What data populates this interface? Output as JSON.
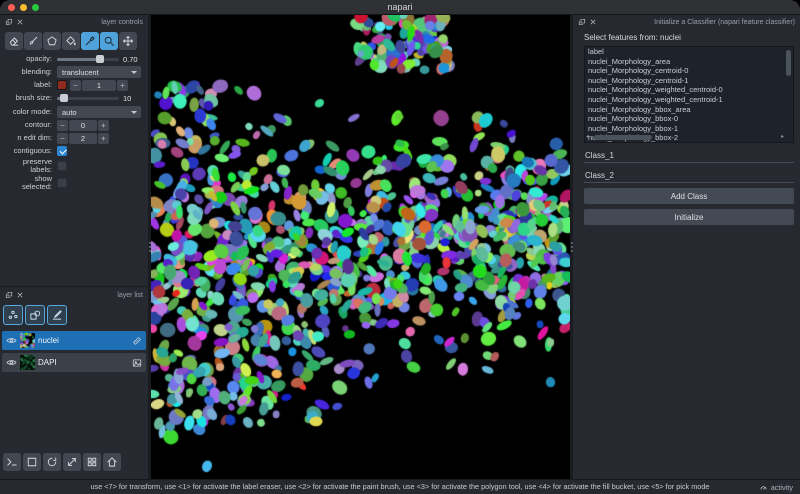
{
  "window": {
    "title": "napari",
    "traffic_lights": [
      "#ff5f57",
      "#febc2e",
      "#28c840"
    ]
  },
  "glyphs": {
    "minus": "−",
    "plus": "+"
  },
  "layer_controls": {
    "title": "layer controls",
    "opacity": {
      "label": "opacity:",
      "value": "0.70",
      "fraction": 0.7
    },
    "blending": {
      "label": "blending:",
      "value": "translucent"
    },
    "label": {
      "label": "label:",
      "value": "1",
      "swatch": "#8f2a1e"
    },
    "brush_size": {
      "label": "brush size:",
      "value": "10",
      "fraction": 0.12
    },
    "color_mode": {
      "label": "color mode:",
      "value": "auto"
    },
    "contour": {
      "label": "contour:",
      "value": "0"
    },
    "n_edit_dim": {
      "label": "n edit dim:",
      "value": "2"
    },
    "contiguous": {
      "label": "contiguous:",
      "checked": true
    },
    "preserve_labels": {
      "label": "preserve\nlabels:",
      "checked": false
    },
    "show_selected": {
      "label": "show\nselected:",
      "checked": false
    }
  },
  "layer_list": {
    "title": "layer list",
    "layers": [
      {
        "name": "nuclei",
        "selected": true
      },
      {
        "name": "DAPI",
        "selected": false
      }
    ]
  },
  "canvas": {
    "background": "#000000",
    "seed": 20,
    "blob_count": 950
  },
  "classifier": {
    "title": "Initialize a Classifier (napari feature classifier)",
    "select_label": "Select features from: nuclei",
    "features": [
      "label",
      "nuclei_Morphology_area",
      "nuclei_Morphology_centroid-0",
      "nuclei_Morphology_centroid-1",
      "nuclei_Morphology_weighted_centroid-0",
      "nuclei_Morphology_weighted_centroid-1",
      "nuclei_Morphology_bbox_area",
      "nuclei_Morphology_bbox-0",
      "nuclei_Morphology_bbox-1",
      "nuclei_Morphology_bbox-2"
    ],
    "class_fields": [
      "Class_1",
      "Class_2"
    ],
    "add_class": "Add Class",
    "initialize": "Initialize"
  },
  "status": {
    "text": "use <7> for transform, use <1> for activate the label eraser, use <2> for activate the paint brush, use <3> for activate the polygon tool, use <4> for activate the fill bucket, use <5> for pick mode",
    "activity": "activity"
  }
}
